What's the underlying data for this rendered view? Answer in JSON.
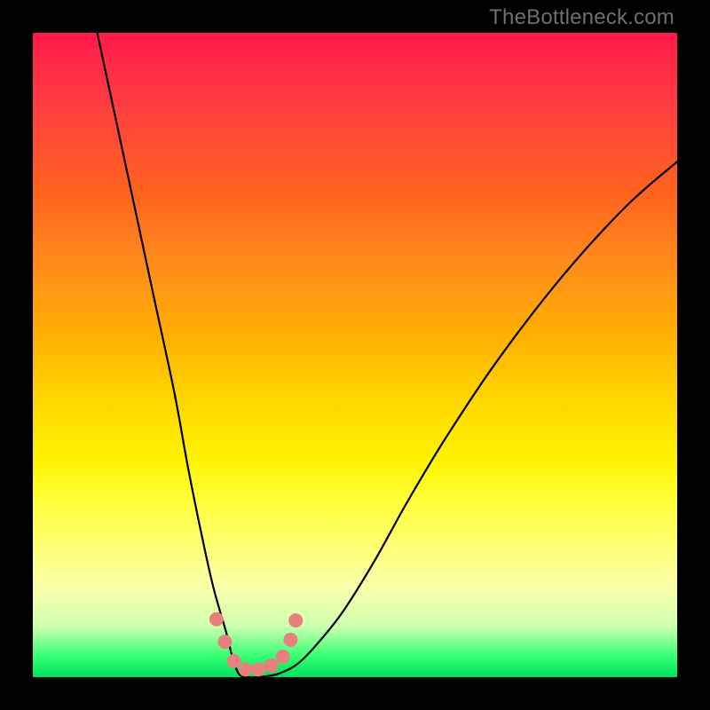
{
  "watermark": "TheBottleneck.com",
  "chart_data": {
    "type": "line",
    "title": "",
    "xlabel": "",
    "ylabel": "",
    "xlim": [
      0,
      100
    ],
    "ylim": [
      0,
      100
    ],
    "series": [
      {
        "name": "curve",
        "x": [
          10,
          13,
          16,
          19,
          22,
          24,
          26,
          28,
          30,
          31,
          32,
          33.5,
          35,
          38,
          41,
          44,
          48,
          53,
          58,
          64,
          72,
          82,
          92,
          100
        ],
        "y": [
          100,
          86,
          72,
          58,
          44,
          33,
          23,
          14,
          7,
          3,
          0.5,
          0,
          0,
          0.5,
          2,
          5,
          10,
          18,
          27,
          37,
          49,
          62,
          73,
          80
        ]
      }
    ],
    "markers": {
      "x": [
        28.5,
        29.8,
        31.2,
        33.0,
        35.0,
        37.0,
        38.8,
        40.0,
        40.8
      ],
      "y": [
        9.0,
        5.5,
        2.5,
        1.2,
        1.2,
        1.8,
        3.2,
        5.8,
        8.8
      ]
    }
  }
}
